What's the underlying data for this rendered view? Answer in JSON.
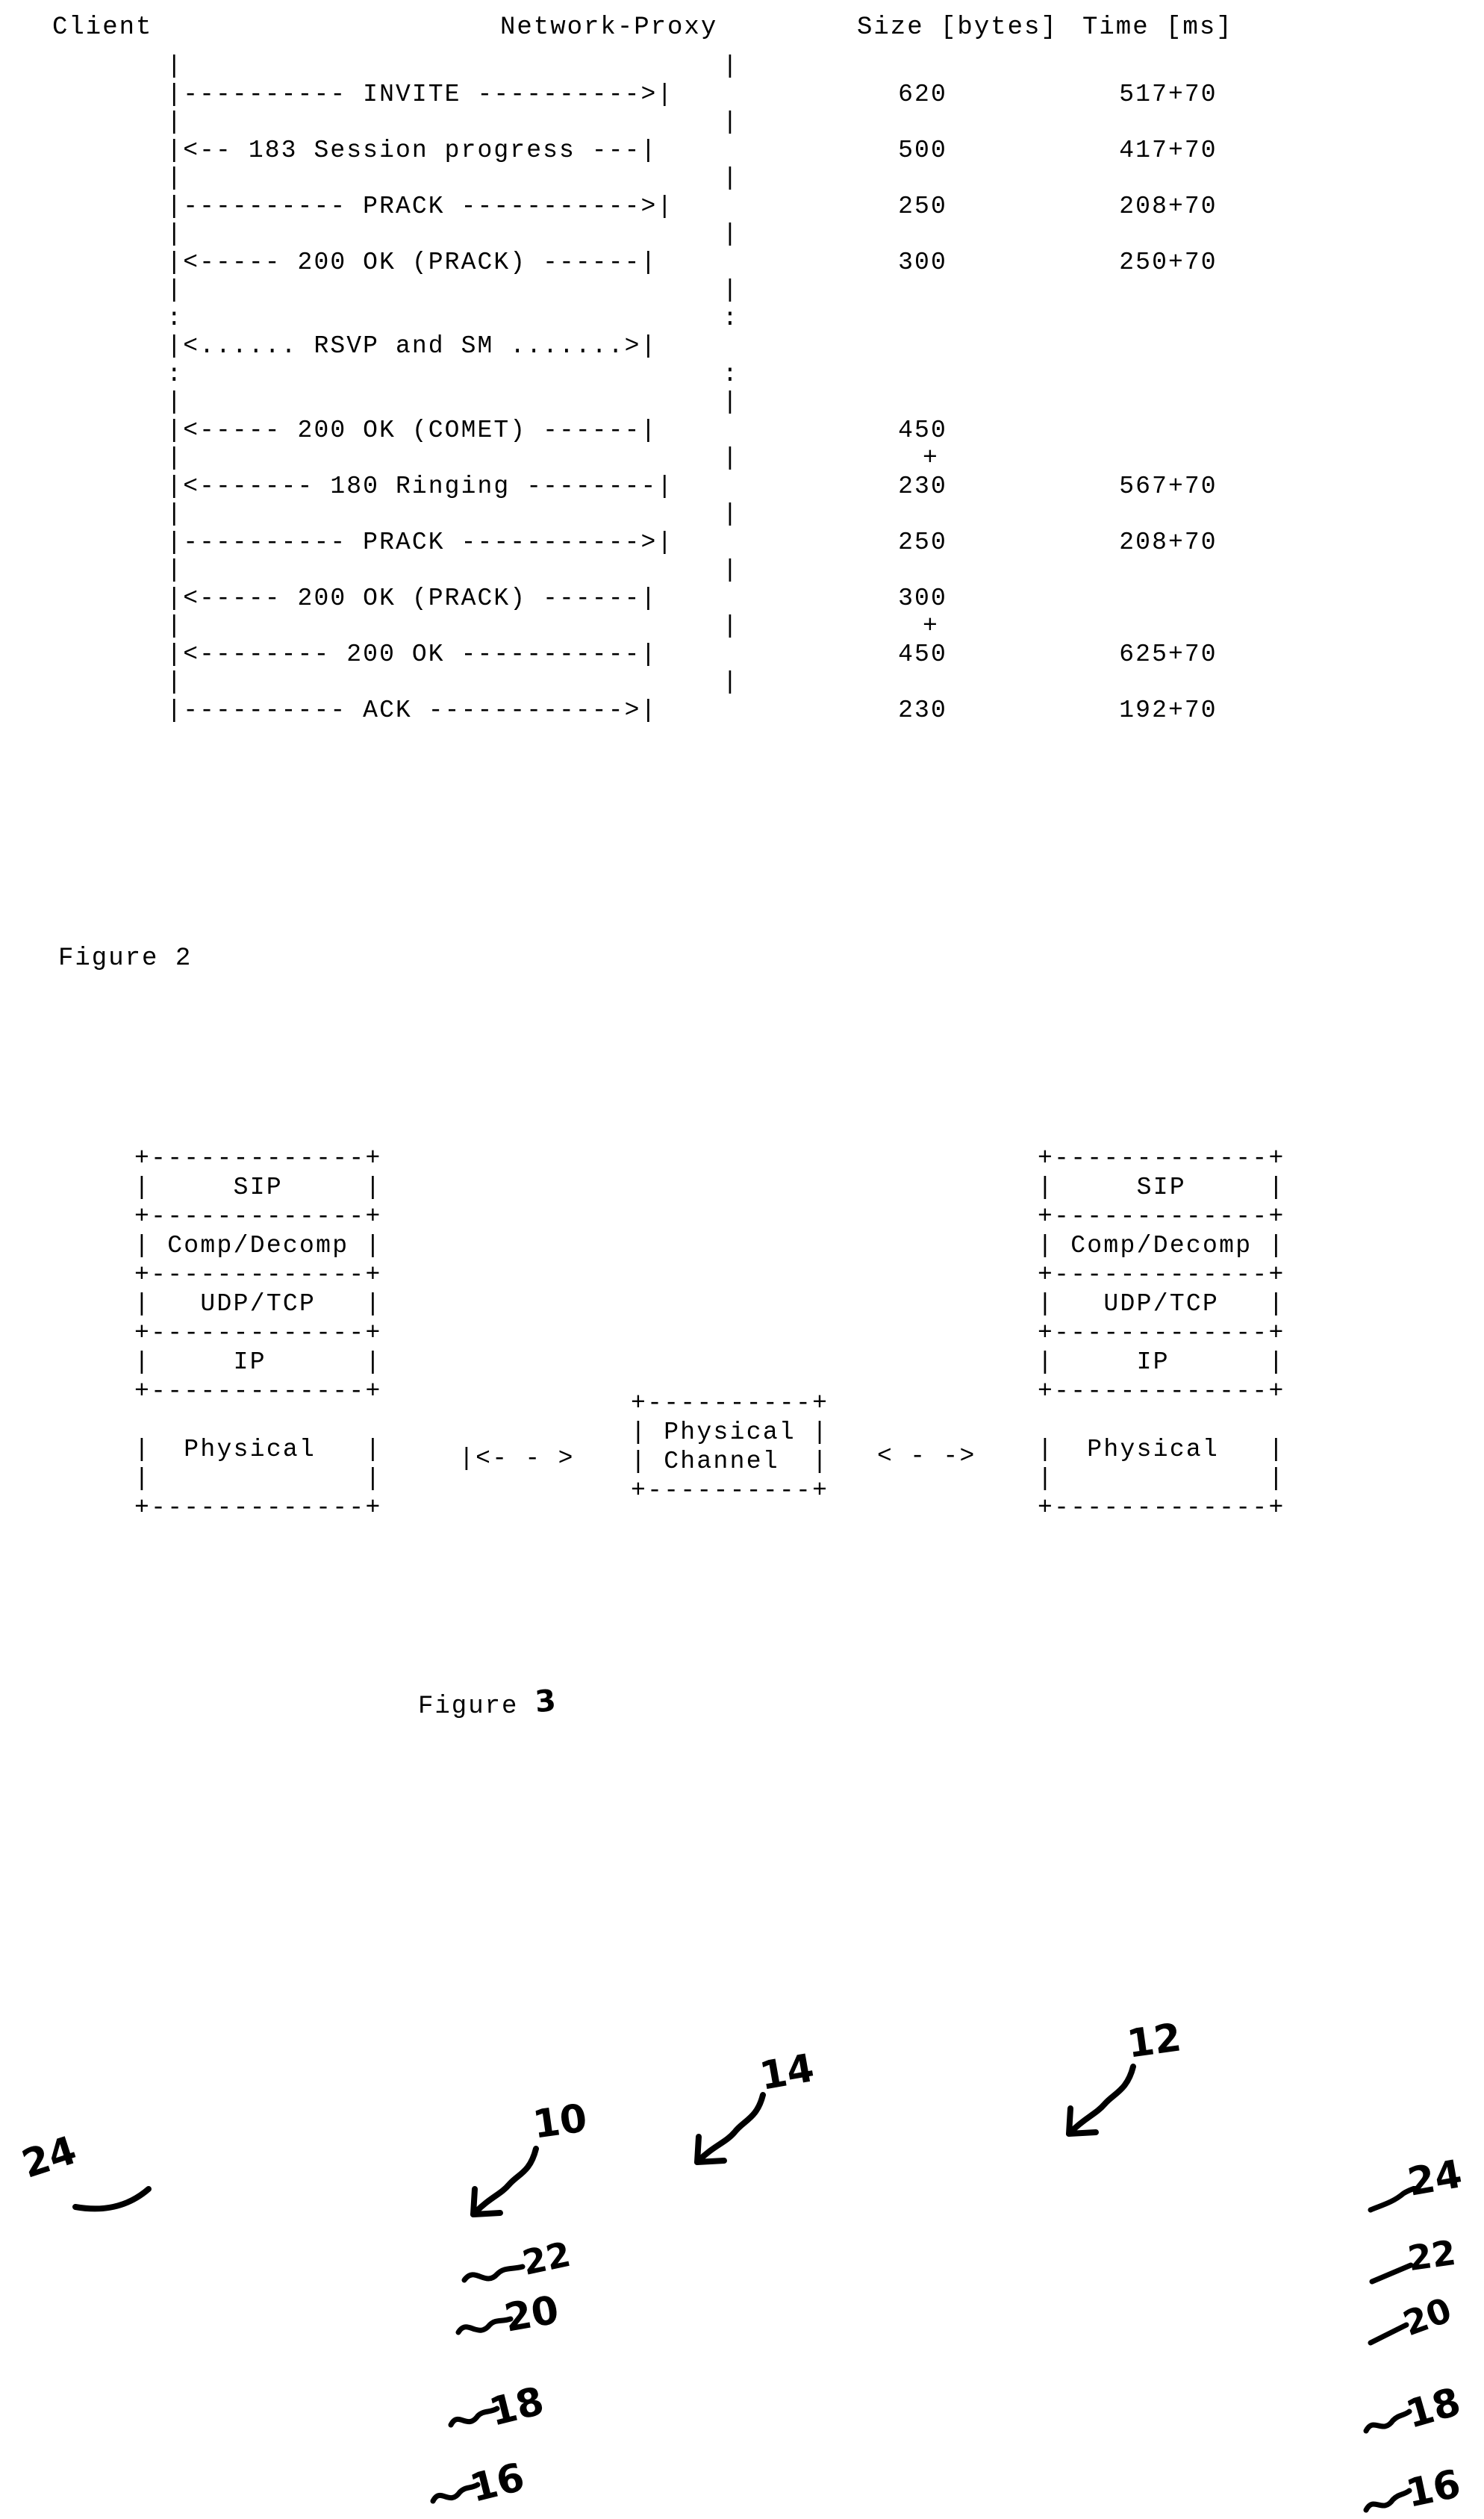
{
  "figure2": {
    "caption": "Figure 2",
    "headers": {
      "client": "Client",
      "proxy": "Network-Proxy",
      "size": "Size [bytes]",
      "time": "Time [ms]"
    },
    "flow_ascii": "       |                                 |\n       |---------- INVITE ---------->|\n       |                                 |\n       |<-- 183 Session progress ---|\n       |                                 |\n       |---------- PRACK ----------->|\n       |                                 |\n       |<----- 200 OK (PRACK) ------|\n       |                                 |\n       :                                 :\n       |<...... RSVP and SM .......>|\n       :                                 :\n       |                                 |\n       |<----- 200 OK (COMET) ------|\n       |                                 |\n       |<------- 180 Ringing --------|\n       |                                 |\n       |---------- PRACK ----------->|\n       |                                 |\n       |<----- 200 OK (PRACK) ------|\n       |                                 |\n       |<-------- 200 OK -----------|\n       |                                 |\n       |---------- ACK ------------>|",
    "messages": [
      {
        "label": "INVITE",
        "direction": "client-to-proxy",
        "size": "620",
        "time": "517+70"
      },
      {
        "label": "183 Session progress",
        "direction": "proxy-to-client",
        "size": "500",
        "time": "417+70"
      },
      {
        "label": "PRACK",
        "direction": "client-to-proxy",
        "size": "250",
        "time": "208+70"
      },
      {
        "label": "200 OK (PRACK)",
        "direction": "proxy-to-client",
        "size": "300",
        "time": "250+70"
      },
      {
        "label": "RSVP and SM",
        "direction": "bidirectional",
        "size": "",
        "time": ""
      },
      {
        "label": "200 OK (COMET)",
        "direction": "proxy-to-client",
        "size": "450",
        "time": ""
      },
      {
        "label": "180 Ringing",
        "direction": "proxy-to-client",
        "size": "230",
        "time": "567+70",
        "size_prefix": "+"
      },
      {
        "label": "PRACK",
        "direction": "client-to-proxy",
        "size": "250",
        "time": "208+70"
      },
      {
        "label": "200 OK (PRACK)",
        "direction": "proxy-to-client",
        "size": "300",
        "time": ""
      },
      {
        "label": "200 OK",
        "direction": "proxy-to-client",
        "size": "450",
        "time": "625+70",
        "size_prefix": "+"
      },
      {
        "label": "ACK",
        "direction": "client-to-proxy",
        "size": "230",
        "time": "192+70"
      }
    ],
    "size_column": "\n620\n\n500\n\n250\n\n300\n\n\n\n\n\n450\n +\n230\n\n250\n\n300\n +\n450\n\n230",
    "time_column": "\n517+70\n\n417+70\n\n208+70\n\n250+70\n\n\n\n\n\n\n\n567+70\n\n208+70\n\n\n\n625+70\n\n192+70"
  },
  "figure3": {
    "caption_text": "Figure ",
    "caption_number": "3",
    "left_stack": {
      "label": "client-protocol-stack",
      "ascii": "+-------------+\n|     SIP     |\n+-------------+\n| Comp/Decomp |\n+-------------+\n|   UDP/TCP   |\n+-------------+\n|     IP      |\n+-------------+\n\n|  Physical   |\n|             |\n+-------------+",
      "layers": [
        "SIP",
        "Comp/Decomp",
        "UDP/TCP",
        "IP",
        "Physical"
      ]
    },
    "right_stack": {
      "label": "proxy-protocol-stack",
      "ascii": "+-------------+\n|     SIP     |\n+-------------+\n| Comp/Decomp |\n+-------------+\n|   UDP/TCP   |\n+-------------+\n|     IP      |\n+-------------+\n\n|  Physical   |\n|             |\n+-------------+",
      "layers": [
        "SIP",
        "Comp/Decomp",
        "UDP/TCP",
        "IP",
        "Physical"
      ]
    },
    "channel": {
      "ascii": "+----------+\n| Physical |\n| Channel  |\n+----------+",
      "lines": [
        "Physical",
        "Channel"
      ]
    },
    "connector_left": "|<- - >",
    "connector_right": "< - ->",
    "reference_numerals": {
      "left_stack_whole": "10",
      "right_stack_whole": "12",
      "physical_channel": "14",
      "physical_layer": "16",
      "ip_layer": "18",
      "udp_tcp_layer": "20",
      "comp_decomp_layer": "22",
      "sip_layer": "24"
    }
  }
}
